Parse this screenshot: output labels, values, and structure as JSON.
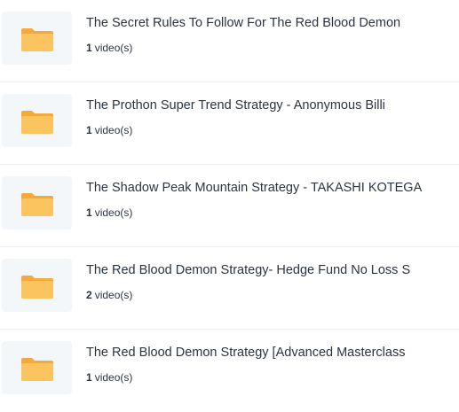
{
  "collections": [
    {
      "title": "The Secret Rules To Follow For The Red Blood Demon",
      "count": "1",
      "unit": "video(s)",
      "icon": "folder-icon"
    },
    {
      "title": "The Prothon Super Trend Strategy - Anonymous Billi",
      "count": "1",
      "unit": "video(s)",
      "icon": "folder-icon"
    },
    {
      "title": "The Shadow Peak Mountain Strategy - TAKASHI KOTEGA",
      "count": "1",
      "unit": "video(s)",
      "icon": "folder-icon"
    },
    {
      "title": "The Red Blood Demon Strategy- Hedge Fund No Loss S",
      "count": "2",
      "unit": "video(s)",
      "icon": "folder-icon"
    },
    {
      "title": "The Red Blood Demon Strategy [Advanced Masterclass",
      "count": "1",
      "unit": "video(s)",
      "icon": "folder-icon"
    }
  ],
  "colors": {
    "folder_back": "#f6a93b",
    "folder_front": "#fcc45e",
    "thumb_bg": "#f4f7fa",
    "separator": "#eef0f3",
    "text": "#2c3440"
  }
}
